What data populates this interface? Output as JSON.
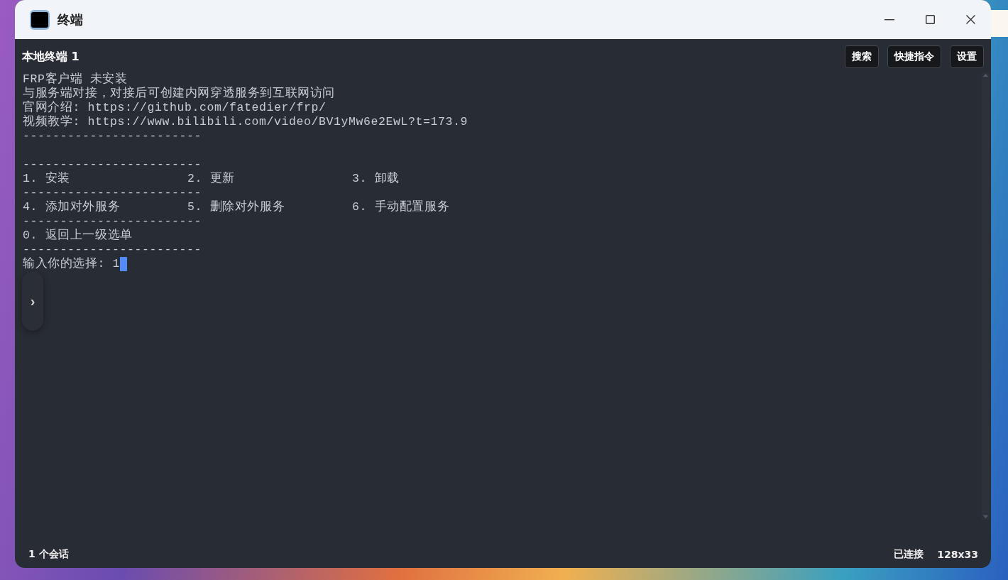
{
  "window": {
    "title": "终端"
  },
  "terminal": {
    "title": "本地终端 1",
    "buttons": [
      "搜索",
      "快捷指令",
      "设置"
    ],
    "lines": [
      {
        "kind": "text",
        "text": "FRP客户端 未安装"
      },
      {
        "kind": "text",
        "text": "与服务端对接，对接后可创建内网穿透服务到互联网访问"
      },
      {
        "kind": "text",
        "text": "官网介绍: https://github.com/fatedier/frp/"
      },
      {
        "kind": "text",
        "text": "视频教学: https://www.bilibili.com/video/BV1yMw6e2EwL?t=173.9"
      },
      {
        "kind": "rule",
        "text": "------------------------"
      },
      {
        "kind": "blank"
      },
      {
        "kind": "rule",
        "text": "------------------------"
      },
      {
        "kind": "menu",
        "items": [
          "1. 安装",
          "2. 更新",
          "3. 卸载"
        ]
      },
      {
        "kind": "rule",
        "text": "------------------------"
      },
      {
        "kind": "menu",
        "items": [
          "4. 添加对外服务",
          "5. 删除对外服务",
          "6. 手动配置服务"
        ]
      },
      {
        "kind": "rule",
        "text": "------------------------"
      },
      {
        "kind": "menu",
        "items": [
          "0. 返回上一级选单"
        ]
      },
      {
        "kind": "rule",
        "text": "------------------------"
      },
      {
        "kind": "prompt",
        "text": "输入你的选择: ",
        "value": "1",
        "cursor": true
      }
    ],
    "side_toggle": "›"
  },
  "status_bar": {
    "sessions": "1 个会话",
    "connection": "已连接",
    "size": "128x33"
  }
}
